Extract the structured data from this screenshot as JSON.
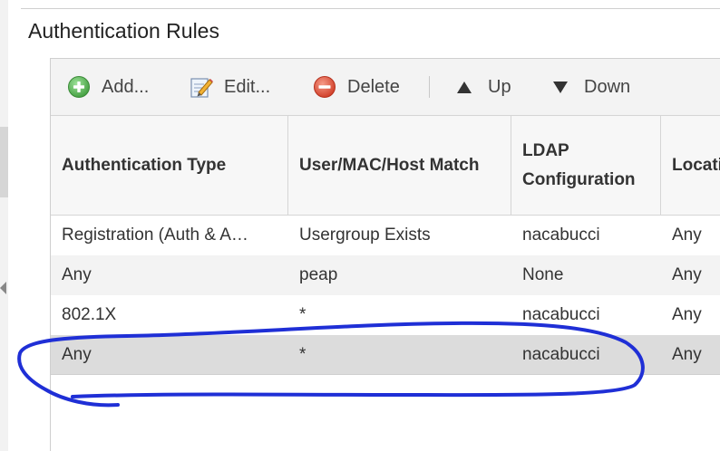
{
  "section": {
    "title": "Authentication Rules"
  },
  "toolbar": {
    "add_label": "Add...",
    "edit_label": "Edit...",
    "delete_label": "Delete",
    "up_label": "Up",
    "down_label": "Down"
  },
  "table": {
    "columns": [
      "Authentication Type",
      "User/MAC/Host Match",
      "LDAP Configuration",
      "Location"
    ],
    "rows": [
      [
        "Registration (Auth & A…",
        "Usergroup Exists",
        "nacabucci",
        "Any"
      ],
      [
        "Any",
        "peap",
        "None",
        "Any"
      ],
      [
        "802.1X",
        "*",
        "nacabucci",
        "Any"
      ],
      [
        "Any",
        "*",
        "nacabucci",
        "Any"
      ]
    ]
  },
  "colors": {
    "add_icon": "#5cb85c",
    "delete_icon": "#e0533d",
    "annotation_stroke": "#1f2fd6",
    "selected_row": "#dcdcdc"
  },
  "icons": {
    "add": "plus-circle-icon",
    "edit": "edit-pencil-icon",
    "delete": "minus-circle-icon",
    "up": "triangle-up-icon",
    "down": "triangle-down-icon"
  }
}
